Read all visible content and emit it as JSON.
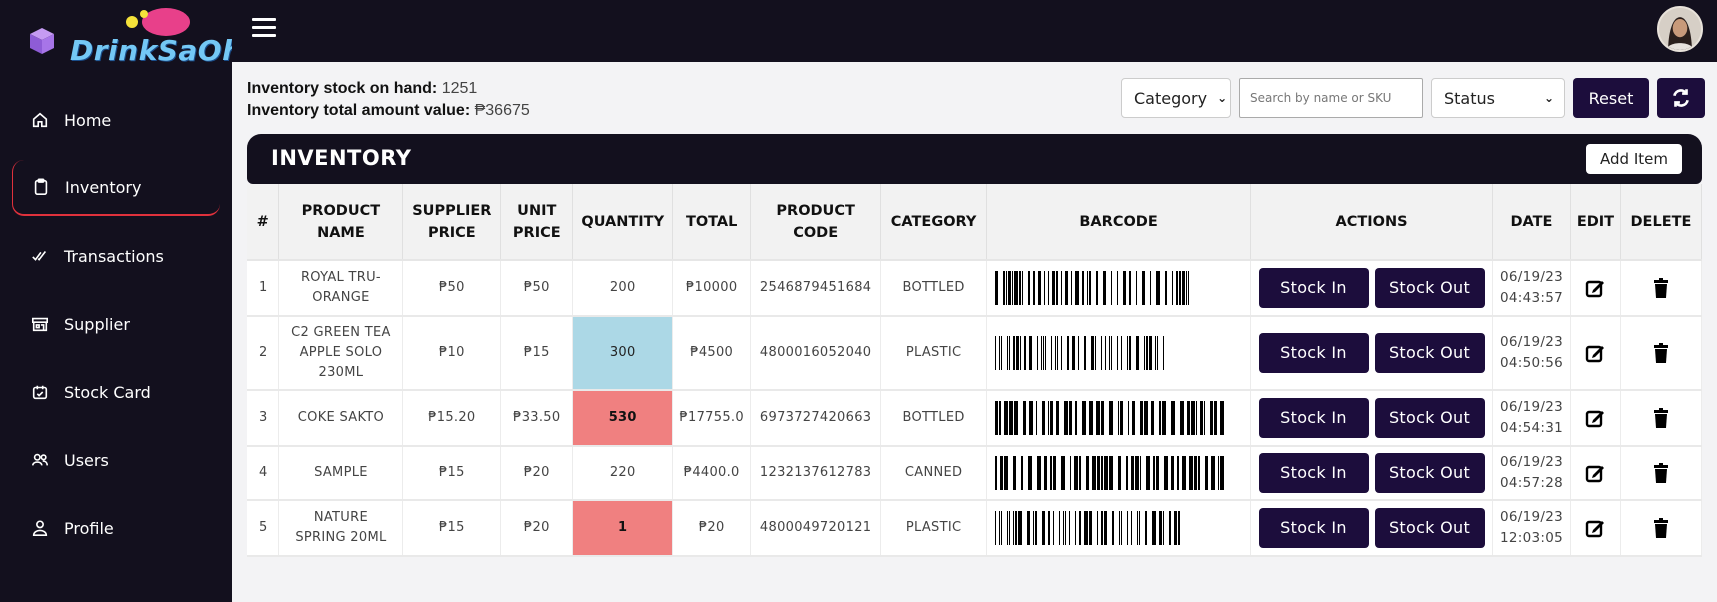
{
  "app": {
    "logo_text": "DrinkSaOh"
  },
  "sidebar": {
    "items": [
      {
        "label": "Home",
        "icon": "home-icon"
      },
      {
        "label": "Inventory",
        "icon": "clipboard-icon",
        "active": true
      },
      {
        "label": "Transactions",
        "icon": "check-double-icon"
      },
      {
        "label": "Supplier",
        "icon": "store-icon"
      },
      {
        "label": "Stock Card",
        "icon": "calendar-check-icon"
      },
      {
        "label": "Users",
        "icon": "users-icon"
      },
      {
        "label": "Profile",
        "icon": "user-icon"
      }
    ]
  },
  "summary": {
    "stock_label": "Inventory stock on hand:",
    "stock_value": "1251",
    "amount_label": "Inventory total amount value:",
    "amount_value": "₱36675"
  },
  "filters": {
    "category_value": "Category",
    "search_placeholder": "Search by name or SKU",
    "status_value": "Status",
    "reset_label": "Reset"
  },
  "card": {
    "title": "INVENTORY",
    "add_label": "Add Item"
  },
  "table": {
    "headers": [
      "#",
      "PRODUCT NAME",
      "SUPPLIER PRICE",
      "UNIT PRICE",
      "QUANTITY",
      "TOTAL",
      "PRODUCT CODE",
      "CATEGORY",
      "BARCODE",
      "ACTIONS",
      "DATE",
      "EDIT",
      "DELETE"
    ],
    "stock_in_label": "Stock In",
    "stock_out_label": "Stock Out",
    "rows": [
      {
        "num": "1",
        "name": "ROYAL TRU-ORANGE",
        "supplier_price": "₱50",
        "unit_price": "₱50",
        "quantity": "200",
        "total": "₱10000",
        "code": "2546879451684",
        "category": "BOTTLED",
        "date": "06/19/23",
        "time": "04:43:57"
      },
      {
        "num": "2",
        "name": "C2 GREEN TEA APPLE SOLO 230ML",
        "supplier_price": "₱10",
        "unit_price": "₱15",
        "quantity": "300",
        "total": "₱4500",
        "code": "4800016052040",
        "category": "PLASTIC",
        "date": "06/19/23",
        "time": "04:50:56"
      },
      {
        "num": "3",
        "name": "COKE SAKTO",
        "supplier_price": "₱15.20",
        "unit_price": "₱33.50",
        "quantity": "530",
        "total": "₱17755.0",
        "code": "6973727420663",
        "category": "BOTTLED",
        "date": "06/19/23",
        "time": "04:54:31"
      },
      {
        "num": "4",
        "name": "SAMPLE",
        "supplier_price": "₱15",
        "unit_price": "₱20",
        "quantity": "220",
        "total": "₱4400.0",
        "code": "1232137612783",
        "category": "CANNED",
        "date": "06/19/23",
        "time": "04:57:28"
      },
      {
        "num": "5",
        "name": "NATURE SPRING 20ML",
        "supplier_price": "₱15",
        "unit_price": "₱20",
        "quantity": "1",
        "total": "₱20",
        "code": "4800049720121",
        "category": "PLASTIC",
        "date": "06/19/23",
        "time": "12:03:05"
      }
    ]
  },
  "colors": {
    "dark": "#13101e",
    "button": "#1c0d3c",
    "qty_blue": "#acd8e6",
    "qty_red": "#f08080",
    "active_border": "#e0313c"
  }
}
